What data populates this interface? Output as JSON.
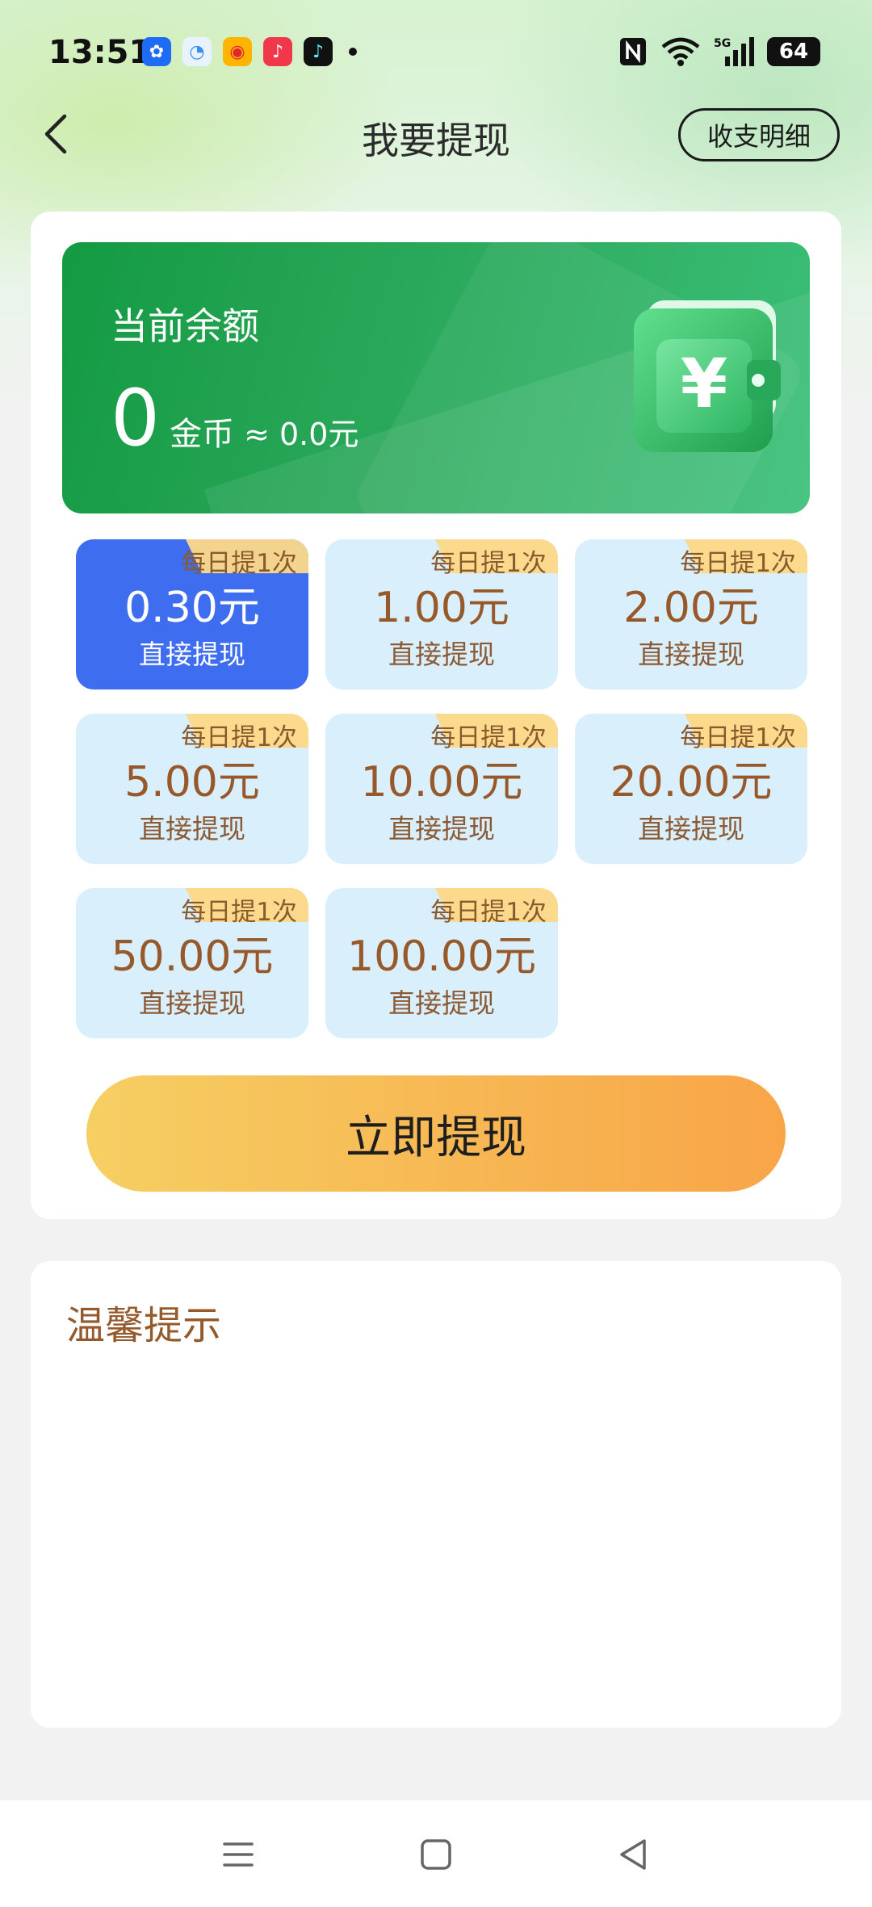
{
  "status_bar": {
    "time": "13:51",
    "app_icons": [
      {
        "name": "pinwheel-app-icon",
        "color": "#1e6cf5",
        "glyph": "✿"
      },
      {
        "name": "browser-app-icon",
        "color": "#e8f3ff",
        "glyph": "◔"
      },
      {
        "name": "weibo-app-icon",
        "color": "#ffb400",
        "glyph": "◉"
      },
      {
        "name": "music-app-icon",
        "color": "#f0384a",
        "glyph": "♪"
      },
      {
        "name": "tiktok-app-icon",
        "color": "#111111",
        "glyph": "♪"
      }
    ],
    "battery": "64"
  },
  "header": {
    "title": "我要提现",
    "records_button": "收支明细"
  },
  "balance": {
    "label": "当前余额",
    "value": "0",
    "unit": "金币",
    "approx": "≈ 0.0元"
  },
  "amount_options": [
    {
      "tag": "每日提1次",
      "amount": "0.30元",
      "sub": "直接提现",
      "selected": true
    },
    {
      "tag": "每日提1次",
      "amount": "1.00元",
      "sub": "直接提现",
      "selected": false
    },
    {
      "tag": "每日提1次",
      "amount": "2.00元",
      "sub": "直接提现",
      "selected": false
    },
    {
      "tag": "每日提1次",
      "amount": "5.00元",
      "sub": "直接提现",
      "selected": false
    },
    {
      "tag": "每日提1次",
      "amount": "10.00元",
      "sub": "直接提现",
      "selected": false
    },
    {
      "tag": "每日提1次",
      "amount": "20.00元",
      "sub": "直接提现",
      "selected": false
    },
    {
      "tag": "每日提1次",
      "amount": "50.00元",
      "sub": "直接提现",
      "selected": false
    },
    {
      "tag": "每日提1次",
      "amount": "100.00元",
      "sub": "直接提现",
      "selected": false
    }
  ],
  "withdraw_button": "立即提现",
  "tips": {
    "title": "温馨提示"
  },
  "colors": {
    "accent_selected": "#3f6df0",
    "tile_bg": "#d9effc",
    "banner_green": "#2aa85a",
    "button_gold": "#f7b552"
  }
}
